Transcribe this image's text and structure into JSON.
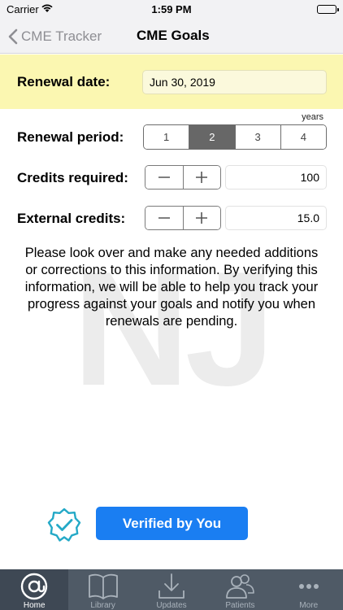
{
  "status_bar": {
    "carrier": "Carrier",
    "time": "1:59 PM"
  },
  "nav": {
    "back_label": "CME Tracker",
    "title": "CME Goals"
  },
  "renewal_date": {
    "label": "Renewal date:",
    "value": "Jun 30, 2019"
  },
  "renewal_period": {
    "label": "Renewal period:",
    "unit_label": "years",
    "options": [
      "1",
      "2",
      "3",
      "4"
    ],
    "selected": "2"
  },
  "credits_required": {
    "label": "Credits required:",
    "value": "100"
  },
  "external_credits": {
    "label": "External credits:",
    "value": "15.0"
  },
  "watermark": "NJ",
  "info_text": "Please look over and make any needed additions or corrections to this information. By verifying this information, we will be able to help you track your progress against your goals and notify you when renewals are pending.",
  "verify": {
    "button_label": "Verified by You",
    "icon": "verified-badge-icon"
  },
  "tabs": [
    {
      "label": "Home",
      "icon": "at-icon",
      "active": true
    },
    {
      "label": "Library",
      "icon": "book-icon",
      "active": false
    },
    {
      "label": "Updates",
      "icon": "download-icon",
      "active": false
    },
    {
      "label": "Patients",
      "icon": "people-icon",
      "active": false
    },
    {
      "label": "More",
      "icon": "more-dots-icon",
      "active": false
    }
  ],
  "colors": {
    "accent_blue": "#1a7ef2",
    "renewal_band": "#fbf7b1",
    "tab_bar": "#4f5a66",
    "verified_icon": "#24a9c7"
  }
}
